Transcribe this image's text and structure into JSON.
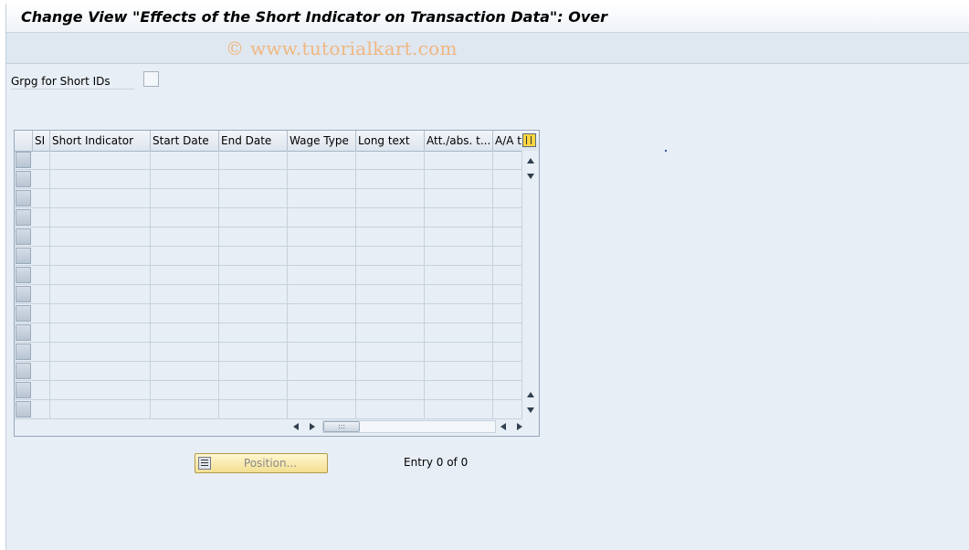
{
  "window": {
    "title": "Change View \"Effects of the Short Indicator on Transaction Data\": Over"
  },
  "toolbar": {
    "watermark": "© www.tutorialkart.com"
  },
  "selection": {
    "grpg_label": "Grpg for Short IDs",
    "grpg_checked": false
  },
  "table": {
    "columns": [
      "SI",
      "Short Indicator",
      "Start Date",
      "End Date",
      "Wage Type",
      "Long text",
      "Att./abs. t...",
      "A/A t"
    ],
    "row_count": 14,
    "settings_icon": "table-settings-icon"
  },
  "footer": {
    "position_button_label": "Position...",
    "entry_text": "Entry 0 of 0"
  },
  "colors": {
    "frame_bg": "#e8eef5",
    "button_bg": "#f3de91",
    "watermark": "#f0b780"
  }
}
